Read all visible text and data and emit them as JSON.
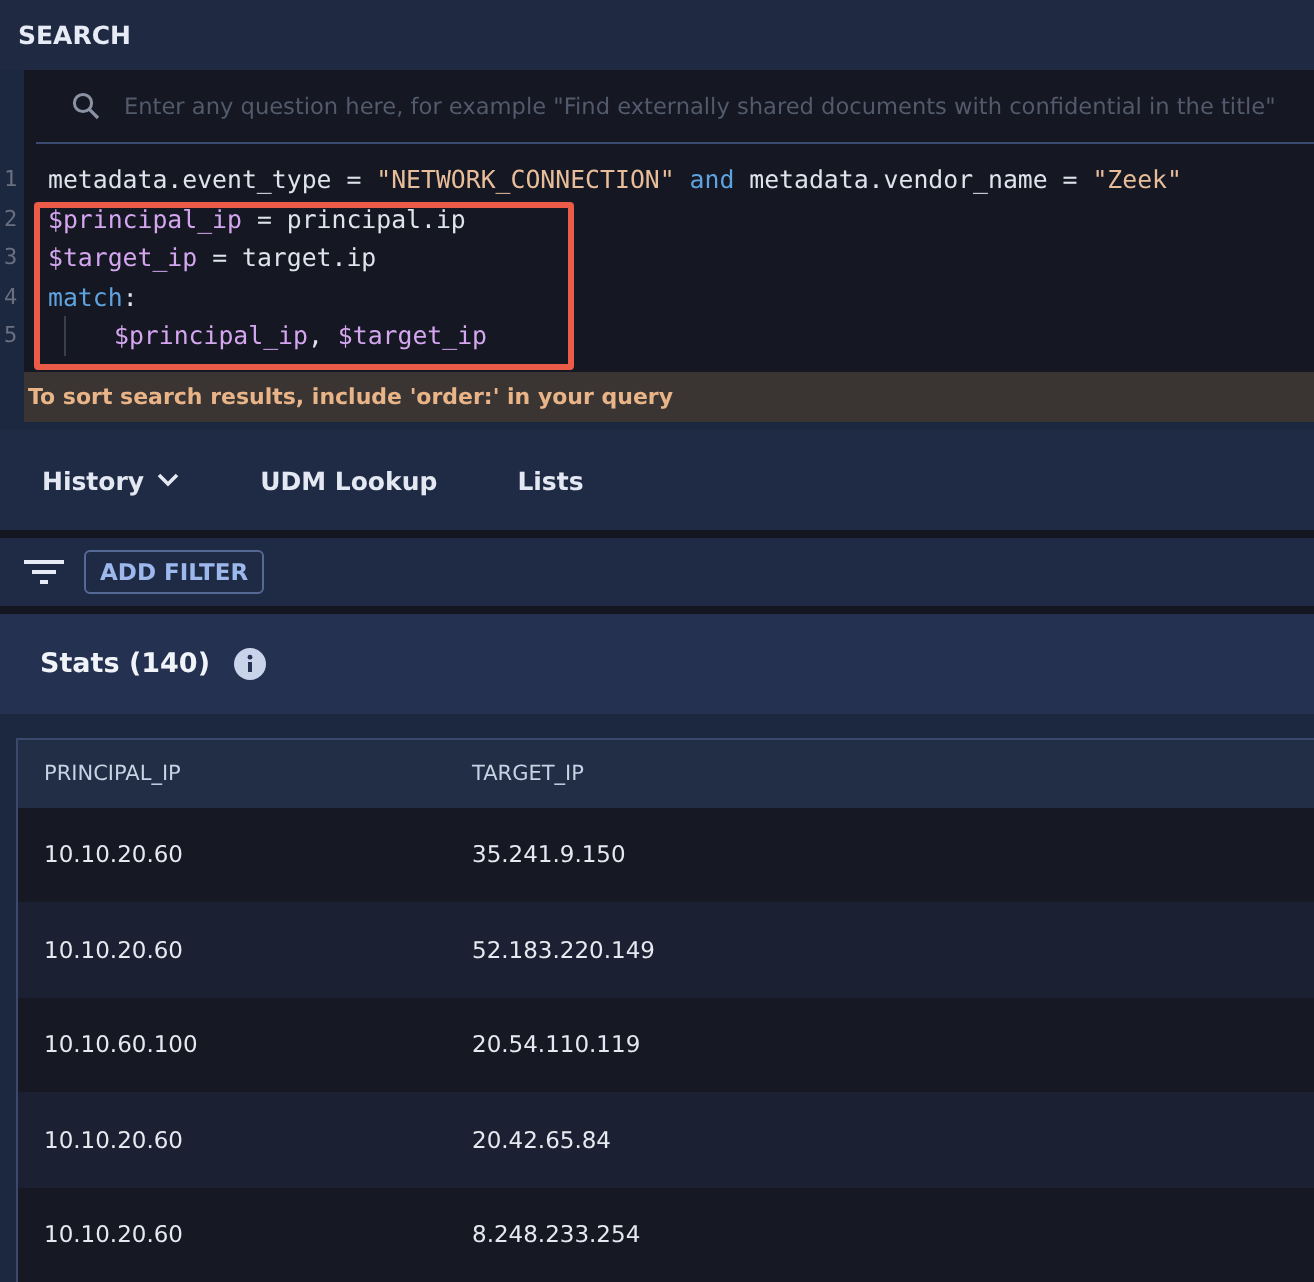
{
  "header": {
    "title": "SEARCH"
  },
  "search": {
    "placeholder": "Enter any question here, for example \"Find externally shared documents with confidential in the title\""
  },
  "code": {
    "lines": [
      {
        "number": "1",
        "indent": false,
        "tokens": [
          {
            "kind": "plain",
            "text": "metadata.event_type = "
          },
          {
            "kind": "string",
            "text": "\"NETWORK_CONNECTION\" "
          },
          {
            "kind": "keyword",
            "text": "and"
          },
          {
            "kind": "plain",
            "text": " metadata.vendor_name = "
          },
          {
            "kind": "string",
            "text": "\"Zeek\""
          }
        ]
      }
    ],
    "highlighted_lines": [
      {
        "number": "2",
        "indent": false,
        "tokens": [
          {
            "kind": "variable",
            "text": "$principal_ip"
          },
          {
            "kind": "plain",
            "text": " = principal.ip"
          }
        ]
      },
      {
        "number": "3",
        "indent": false,
        "tokens": [
          {
            "kind": "variable",
            "text": "$target_ip"
          },
          {
            "kind": "plain",
            "text": " = target.ip"
          }
        ]
      },
      {
        "number": "4",
        "indent": false,
        "tokens": [
          {
            "kind": "keyword",
            "text": "match"
          },
          {
            "kind": "plain",
            "text": ":"
          }
        ]
      },
      {
        "number": "5",
        "indent": true,
        "tokens": [
          {
            "kind": "variable",
            "text": "$principal_ip"
          },
          {
            "kind": "plain",
            "text": ", "
          },
          {
            "kind": "variable",
            "text": "$target_ip"
          }
        ]
      }
    ]
  },
  "warning": "To sort search results, include 'order:' in your query",
  "tabs": [
    {
      "label": "History",
      "kind": "dropdown"
    },
    {
      "label": "UDM Lookup",
      "kind": "plain"
    },
    {
      "label": "Lists",
      "kind": "plain"
    }
  ],
  "filter_button": "ADD FILTER",
  "stats": {
    "title": "Stats (140)"
  },
  "table": {
    "columns": [
      "PRINCIPAL_IP",
      "TARGET_IP"
    ],
    "rows": [
      [
        "10.10.20.60",
        "35.241.9.150"
      ],
      [
        "10.10.20.60",
        "52.183.220.149"
      ],
      [
        "10.10.60.100",
        "20.54.110.119"
      ],
      [
        "10.10.20.60",
        "20.42.65.84"
      ],
      [
        "10.10.20.60",
        "8.248.233.254"
      ]
    ]
  }
}
